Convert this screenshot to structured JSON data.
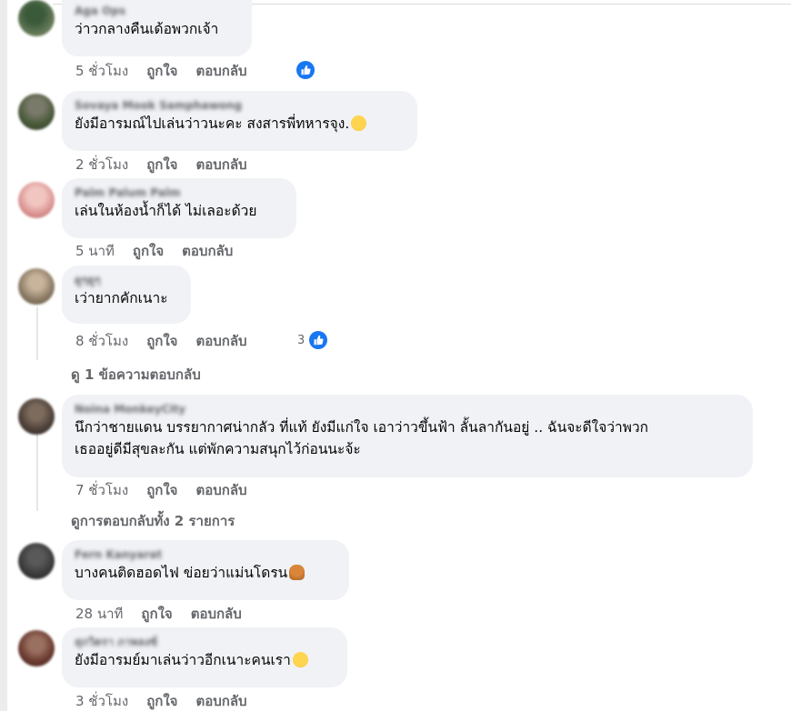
{
  "comments": [
    {
      "author": "Aga Ops",
      "text": "ว่าวกลางคืนเด้อพวกเจ้า",
      "time": "5 ชั่วโมง",
      "like_label": "ถูกใจ",
      "reply_label": "ตอบกลับ",
      "reactions": ""
    },
    {
      "author": "Sovaya Mook Samphawong",
      "text": "ยังมีอารมณ์ไปเล่นว่าวนะคะ สงสารพี่ทหารจุง.",
      "time": "2 ชั่วโมง",
      "like_label": "ถูกใจ",
      "reply_label": "ตอบกลับ"
    },
    {
      "author": "Palm Palum Palm",
      "text": "เล่นในห้องน้ำก็ได้ ไม่เลอะด้วย",
      "time": "5 นาที",
      "like_label": "ถูกใจ",
      "reply_label": "ตอบกลับ"
    },
    {
      "author": "ดูๆดูๆ",
      "text": "เว่ายากคักเนาะ",
      "time": "8 ชั่วโมง",
      "like_label": "ถูกใจ",
      "reply_label": "ตอบกลับ",
      "reactions": "3",
      "view_replies": "ดู 1 ข้อความตอบกลับ"
    },
    {
      "author": "Noina MonkeyCity",
      "text_line1": "นึกว่าชายแดน บรรยากาศน่ากลัว ที่แท้ ยังมีแก่ใจ เอาว่าวขึ้นฟ้า ลั้นลากันอยู่ .. ฉันจะดีใจว่าพวก",
      "text_line2": "เธออยู่ดีมีสุขละกัน แต่พักความสนุกไว้ก่อนนะจ้ะ",
      "time": "7 ชั่วโมง",
      "like_label": "ถูกใจ",
      "reply_label": "ตอบกลับ",
      "view_replies": "ดูการตอบกลับทั้ง 2 รายการ"
    },
    {
      "author": "Fern Kanyarat",
      "text": "บางคนติดฮอดไฟ ข่อยว่าแม่นโดรน",
      "time": "28 นาที",
      "like_label": "ถูกใจ",
      "reply_label": "ตอบกลับ"
    },
    {
      "author": "สุภวิตรา ภาพลงซ์",
      "text": "ยังมีอารมย์มาเล่นว่าวอีกเนาะคนเรา",
      "time": "3 ชั่วโมง",
      "like_label": "ถูกใจ",
      "reply_label": "ตอบกลับ"
    }
  ],
  "icons": {
    "like": "thumbs-up-icon"
  },
  "colors": {
    "bubble": "#f0f2f5",
    "meta_text": "#65676b",
    "like_blue": "#1877f2"
  }
}
